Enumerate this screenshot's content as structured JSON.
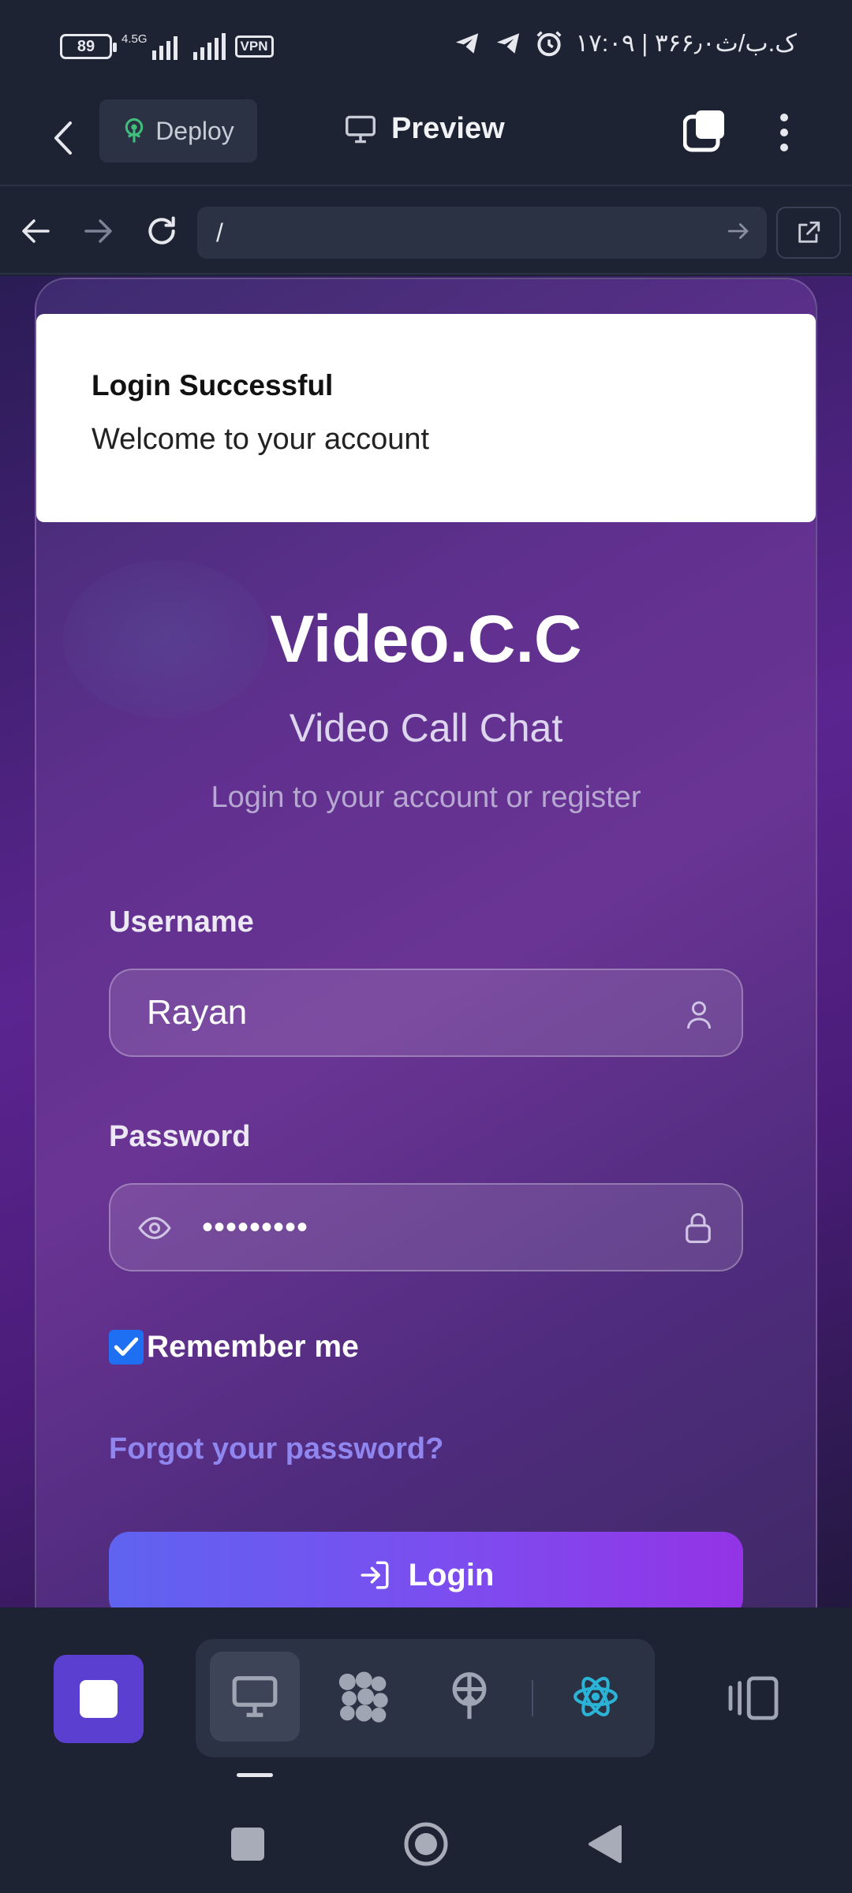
{
  "status_bar": {
    "battery": "89",
    "network": "4.5G",
    "vpn": "VPN",
    "time_text": "۱۷:۰۹ | ۳۶۶٫۰ک.ب/ث"
  },
  "top_bar": {
    "deploy_label": "Deploy",
    "preview_label": "Preview"
  },
  "browser": {
    "url": "/"
  },
  "toast": {
    "title": "Login Successful",
    "message": "Welcome to your account"
  },
  "login": {
    "app_title": "Video.C.C",
    "subtitle": "Video Call Chat",
    "hint": "Login to your account or register",
    "username_label": "Username",
    "username_value": "Rayan",
    "password_label": "Password",
    "password_value": "•••••••••",
    "remember_label": "Remember me",
    "remember_checked": true,
    "forgot_link": "Forgot your password?",
    "login_button": "Login"
  },
  "colors": {
    "accent": "#5a3fd0",
    "login_gradient_start": "#5f63f0",
    "login_gradient_end": "#9334e6",
    "link": "#8f86f0"
  }
}
